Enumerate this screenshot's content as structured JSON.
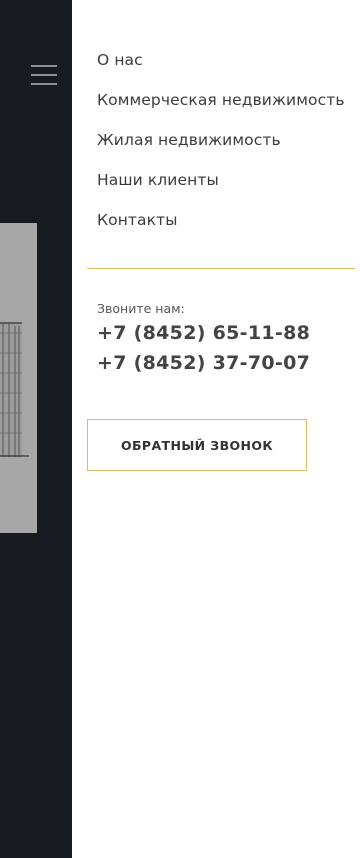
{
  "header": {
    "menu_icon": "hamburger-icon"
  },
  "nav": {
    "items": [
      {
        "label": "О нас"
      },
      {
        "label": "Коммерческая недвижимость"
      },
      {
        "label": "Жилая недвижимость"
      },
      {
        "label": "Наши клиенты"
      },
      {
        "label": "Контакты"
      }
    ]
  },
  "contacts": {
    "call_label": "Звоните нам:",
    "phone_1": "+7 (8452) 65-11-88",
    "phone_2": "+7 (8452) 37-70-07"
  },
  "callback": {
    "label": "ОБРАТНЫЙ ЗВОНОК"
  },
  "colors": {
    "accent": "#d9bc66",
    "dark_background": "#181a21",
    "panel": "#ffffff"
  }
}
